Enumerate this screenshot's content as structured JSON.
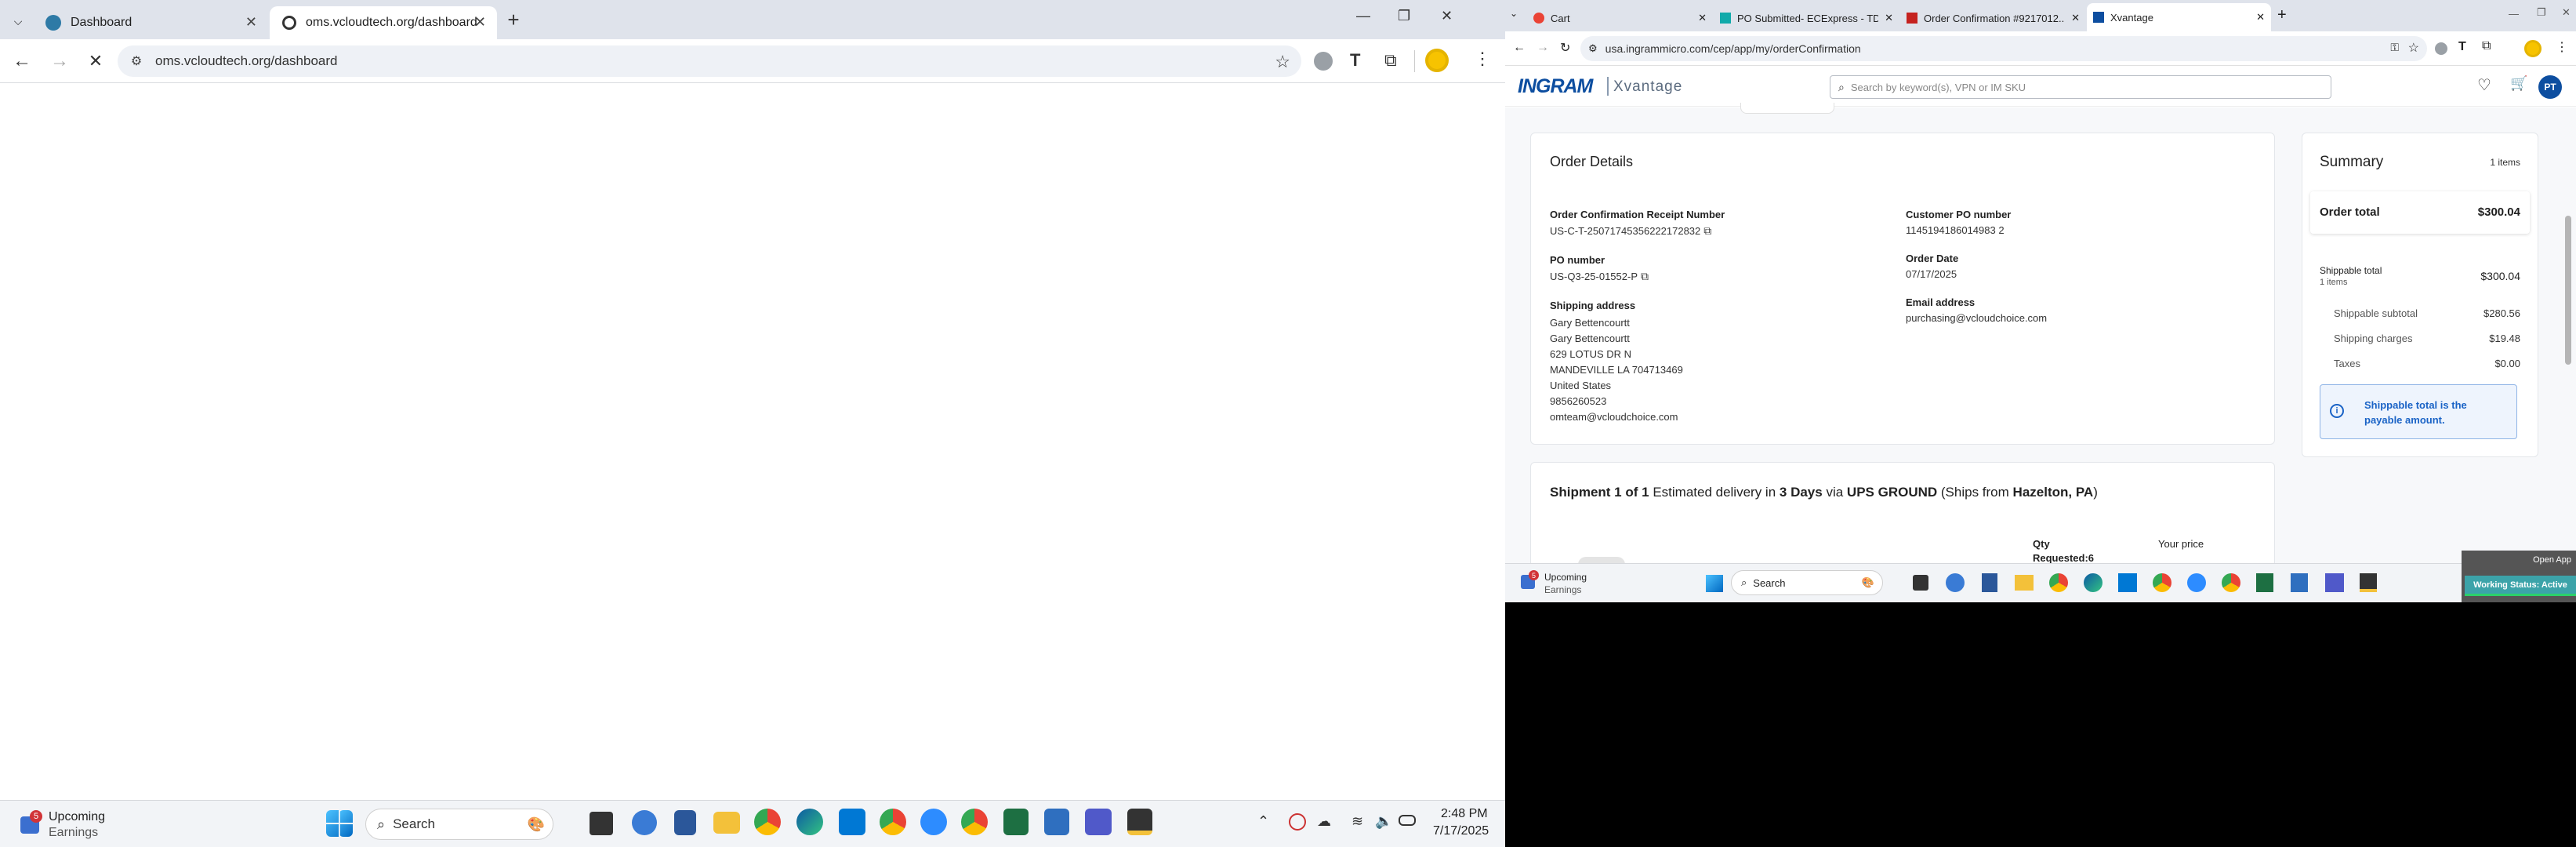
{
  "left": {
    "tabs": [
      {
        "label": "Dashboard",
        "active": false
      },
      {
        "label": "oms.vcloudtech.org/dashboard",
        "active": true
      }
    ],
    "url": "oms.vcloudtech.org/dashboard",
    "taskbar": {
      "weather_title": "Upcoming",
      "weather_sub": "Earnings",
      "badge": "5",
      "search": "Search",
      "time": "2:48 PM",
      "date": "7/17/2025"
    }
  },
  "right": {
    "tabs": [
      {
        "label": "Cart"
      },
      {
        "label": "PO Submitted- ECExpress - TD"
      },
      {
        "label": "Order Confirmation #9217012..."
      },
      {
        "label": "Xvantage"
      }
    ],
    "url": "usa.ingrammicro.com/cep/app/my/orderConfirmation",
    "brand": {
      "ingram": "INGRAM",
      "xvantage": "Xvantage"
    },
    "search_placeholder": "Search by keyword(s), VPN or IM SKU",
    "avatar": "PT",
    "order": {
      "title": "Order Details",
      "receipt_label": "Order Confirmation Receipt Number",
      "receipt_value": "US-C-T-25071745356222172832",
      "customer_po_label": "Customer PO number",
      "customer_po_value": "1145194186014983 2",
      "po_label": "PO number",
      "po_value": "US-Q3-25-01552-P",
      "date_label": "Order Date",
      "date_value": "07/17/2025",
      "ship_label": "Shipping address",
      "ship_lines": [
        "Gary Bettencourtt",
        "Gary Bettencourtt",
        "629 LOTUS DR N",
        "MANDEVILLE LA 704713469",
        "United States",
        "9856260523",
        "omteam@vcloudchoice.com"
      ],
      "email_label": "Email address",
      "email_value": "purchasing@vcloudchoice.com"
    },
    "summary": {
      "title": "Summary",
      "items": "1 items",
      "order_total_label": "Order total",
      "order_total": "$300.04",
      "shippable_total_label": "Shippable total",
      "shippable_items": "1 items",
      "shippable_total": "$300.04",
      "subtotal_label": "Shippable subtotal",
      "subtotal": "$280.56",
      "shipping_label": "Shipping charges",
      "shipping": "$19.48",
      "taxes_label": "Taxes",
      "taxes": "$0.00",
      "note": "Shippable total is the payable amount."
    },
    "shipment": {
      "prefix": "Shipment 1 of 1",
      "est": "Estimated delivery in",
      "days": "3 Days",
      "via": "via",
      "carrier": "UPS GROUND",
      "from_pre": "(Ships from",
      "from": "Hazelton, PA",
      "from_post": ")",
      "qty_label": "Qty",
      "requested": "Requested:6",
      "price_label": "Your price"
    },
    "overlay": {
      "open_app": "Open App",
      "status": "Working Status: Active"
    },
    "taskbar": {
      "weather_title": "Upcoming",
      "weather_sub": "Earnings",
      "badge": "5",
      "search": "Search"
    }
  }
}
